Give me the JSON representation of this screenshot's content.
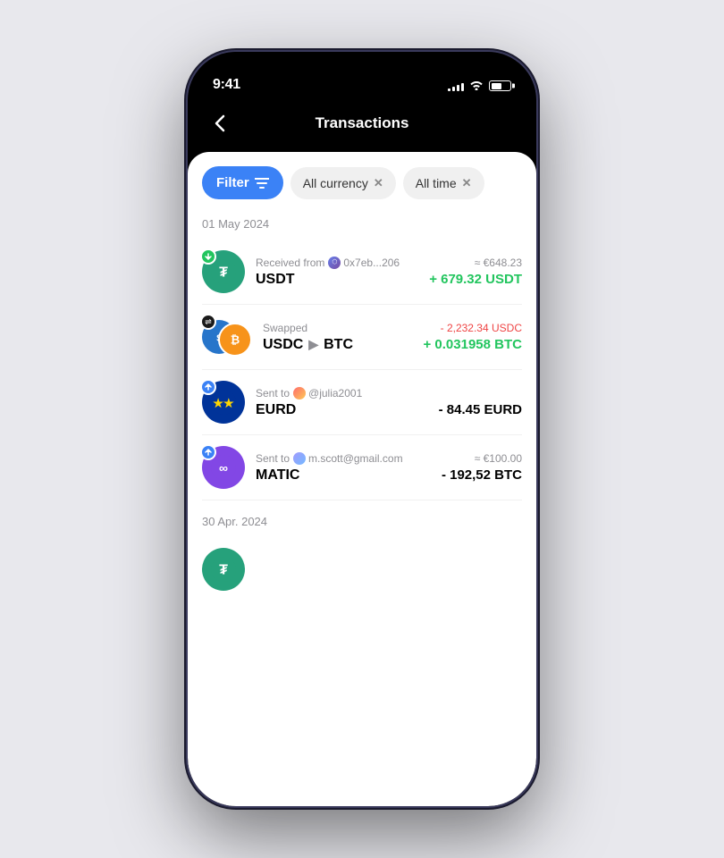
{
  "statusBar": {
    "time": "9:41",
    "signalBars": [
      3,
      5,
      7,
      9,
      11
    ],
    "batteryPercent": 55
  },
  "header": {
    "backLabel": "<",
    "title": "Transactions"
  },
  "filters": {
    "filterLabel": "Filter",
    "tags": [
      {
        "label": "All currency",
        "id": "currency"
      },
      {
        "label": "All time",
        "id": "time"
      }
    ]
  },
  "sections": [
    {
      "date": "01 May 2024",
      "transactions": [
        {
          "id": "usdt-receive",
          "type": "receive",
          "coin": "USDT",
          "coinColor": "#26a17b",
          "arrowColor": "#22c55e",
          "arrowDir": "down",
          "labelPrefix": "Received from",
          "labelAddress": "0x7eb...206",
          "labelAddressType": "eth",
          "coinName": "USDT",
          "approxAmount": "≈ €648.23",
          "amount": "+ 679.32 USDT",
          "amountClass": "positive"
        },
        {
          "id": "usdc-btc-swap",
          "type": "swap",
          "coinFrom": "USDC",
          "coinFromColor": "#2775ca",
          "coinTo": "BTC",
          "coinToColor": "#f7931a",
          "labelPrefix": "Swapped",
          "labelAddress": "",
          "coinNameFrom": "USDC",
          "coinNameTo": "BTC",
          "approxAmount": "- 2,232.34 USDC",
          "amount": "+ 0.031958 BTC",
          "amountClass": "positive",
          "approxClass": "swap-negative"
        },
        {
          "id": "eurd-send",
          "type": "send",
          "coin": "EURD",
          "coinColor": "#003399",
          "arrowColor": "#3B82F6",
          "arrowDir": "up",
          "labelPrefix": "Sent to",
          "labelAddress": "@julia2001",
          "labelAddressType": "user",
          "coinName": "EURD",
          "approxAmount": "",
          "amount": "- 84.45 EURD",
          "amountClass": "negative"
        },
        {
          "id": "matic-send",
          "type": "send",
          "coin": "MATIC",
          "coinColor": "#8247e5",
          "arrowColor": "#3B82F6",
          "arrowDir": "up",
          "labelPrefix": "Sent to",
          "labelAddress": "m.scott@gmail.com",
          "labelAddressType": "user2",
          "coinName": "MATIC",
          "approxAmount": "≈ €100.00",
          "amount": "- 192,52 BTC",
          "amountClass": "negative"
        }
      ]
    },
    {
      "date": "30 Apr. 2024",
      "transactions": []
    }
  ]
}
